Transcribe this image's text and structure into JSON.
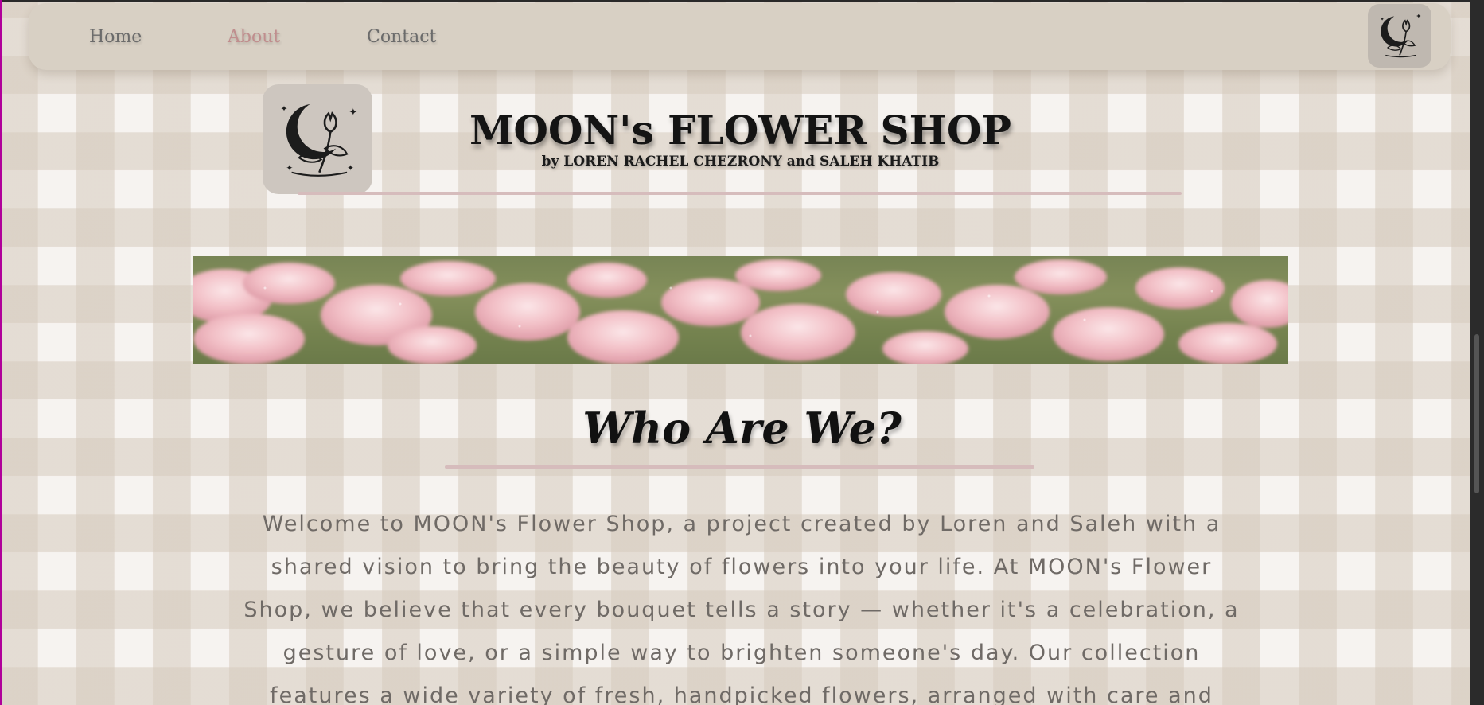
{
  "nav": {
    "items": [
      {
        "label": "Home"
      },
      {
        "label": "About"
      },
      {
        "label": "Contact"
      }
    ],
    "logo_icon": "moon-tulip-logo-icon"
  },
  "header": {
    "logo_icon": "moon-tulip-logo-icon",
    "title": "MOON's FLOWER SHOP",
    "subtitle": "by LOREN RACHEL CHEZRONY and SALEH KHATIB"
  },
  "banner": {
    "subject": "pink tulip field"
  },
  "about": {
    "heading": "Who Are We?",
    "text": "Welcome to MOON's Flower Shop, a project created by Loren and Saleh with a shared vision to bring the beauty of flowers into your life. At MOON's Flower Shop, we believe that every bouquet tells a story — whether it's a celebration, a gesture of love, or a simple way to brighten someone's day. Our collection features a wide variety of fresh, handpicked flowers, arranged with care and"
  },
  "colors": {
    "nav_bg": "#d8d0c4",
    "active_link": "#c08e8e",
    "divider": "#d6bcbc",
    "text_muted": "#6f6a66"
  }
}
